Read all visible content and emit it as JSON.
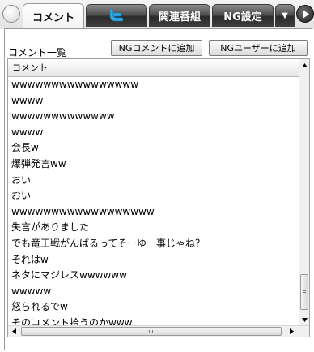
{
  "tabs": [
    {
      "label": "コメント",
      "active": true
    },
    {
      "label": "",
      "icon": "twitter-bird-icon",
      "active": false
    },
    {
      "label": "関連番組",
      "active": false
    },
    {
      "label": "NG設定",
      "active": false
    },
    {
      "label": "▼",
      "active": false
    }
  ],
  "panel": {
    "title": "コメント一覧",
    "ng_comment_button": "NGコメントに追加",
    "ng_user_button": "NGユーザーに追加"
  },
  "list": {
    "column_header": "コメント",
    "rows": [
      "wwwwwwwwwwwwwwww",
      "wwww",
      "wwwwwwwwwwwww",
      "wwww",
      "会長w",
      "爆弾発言ww",
      "おい",
      "おい",
      "wwwwwwwwwwwwwwwwww",
      "失言がありました",
      "でも竜王戦がんばるってそーゆー事じゃね？",
      "それはw",
      "ネタにマジレスwwwwww",
      "wwwww",
      "怒られるでw",
      "そのコメント拾うのかwww"
    ]
  },
  "colors": {
    "twitter_blue": "#33a7e0",
    "tab_dark": "#3a3a3a"
  }
}
